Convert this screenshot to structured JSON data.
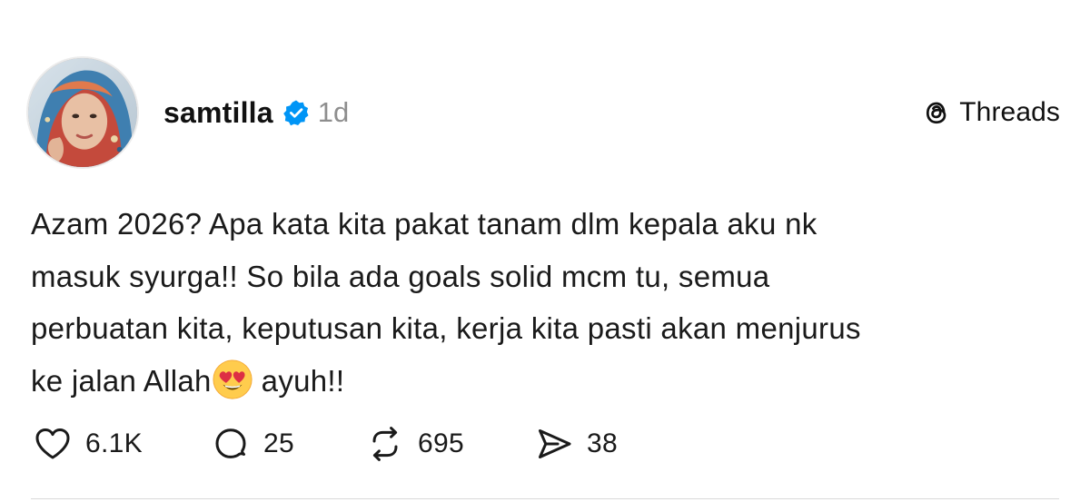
{
  "post": {
    "username": "samtilla",
    "verified": true,
    "timestamp": "1d",
    "brand": "Threads",
    "text_lines": [
      "Azam 2026? Apa kata kita pakat tanam dlm kepala aku nk",
      "masuk syurga!! So bila ada goals solid mcm tu, semua",
      "perbuatan kita, keputusan kita, kerja kita pasti akan menjurus"
    ],
    "last_line_before_emoji": "ke jalan Allah",
    "emoji": "smiling-face-with-heart-eyes",
    "last_line_after_emoji": "ayuh!!"
  },
  "actions": {
    "likes": "6.1K",
    "replies": "25",
    "reposts": "695",
    "shares": "38"
  },
  "icons": {
    "like": "heart-icon",
    "reply": "comment-bubble-icon",
    "repost": "repost-icon",
    "share": "send-icon",
    "verified": "verified-badge-icon",
    "brand": "threads-logo-icon"
  },
  "colors": {
    "verified_badge": "#0095f6",
    "timestamp": "#8e8e8e",
    "text": "#1a1a1a"
  }
}
